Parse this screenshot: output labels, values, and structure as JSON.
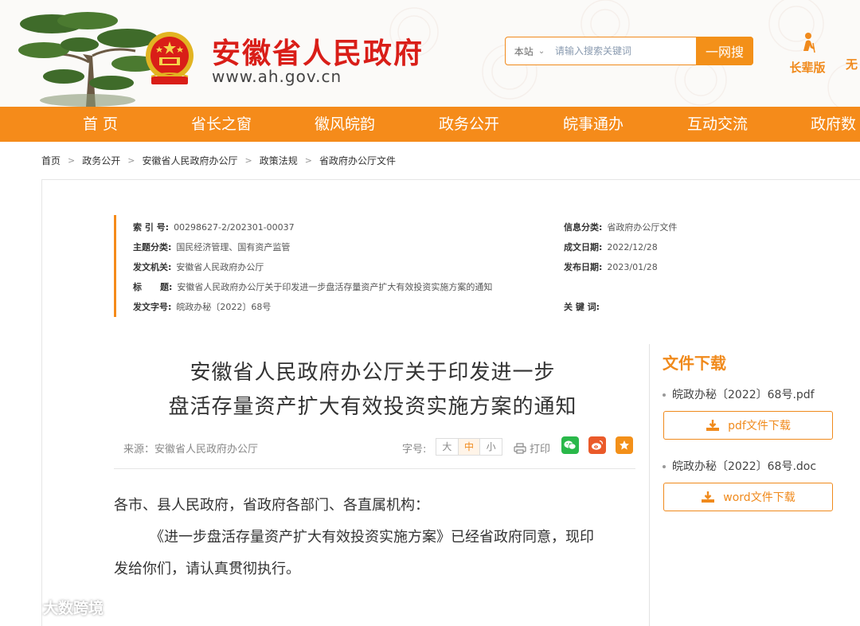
{
  "header": {
    "site_name": "安徽省人民政府",
    "site_url": "www.ah.gov.cn",
    "search": {
      "scope": "本站",
      "placeholder": "请输入搜索关键词",
      "button": "一网搜"
    },
    "elder_mode": "长辈版",
    "accessibility": "无"
  },
  "nav": {
    "items": [
      "首 页",
      "省长之窗",
      "徽风皖韵",
      "政务公开",
      "皖事通办",
      "互动交流",
      "政府数"
    ]
  },
  "breadcrumb": [
    "首页",
    "政务公开",
    "安徽省人民政府办公厅",
    "政策法规",
    "省政府办公厅文件"
  ],
  "meta": {
    "index_key": "索 引 号:",
    "index_val": "00298627-2/202301-00037",
    "category_key": "信息分类:",
    "category_val": "省政府办公厅文件",
    "topic_key": "主题分类:",
    "topic_val": "国民经济管理、国有资产监管",
    "created_key": "成文日期:",
    "created_val": "2022/12/28",
    "issuer_key": "发文机关:",
    "issuer_val": "安徽省人民政府办公厅",
    "published_key": "发布日期:",
    "published_val": "2023/01/28",
    "title_key": "标      题:",
    "title_val": "安徽省人民政府办公厅关于印发进一步盘活存量资产扩大有效投资实施方案的通知",
    "docno_key": "发文字号:",
    "docno_val": "皖政办秘〔2022〕68号",
    "keywords_key": "关 键 词:"
  },
  "article": {
    "title_line1": "安徽省人民政府办公厅关于印发进一步",
    "title_line2": "盘活存量资产扩大有效投资实施方案的通知",
    "source": "来源：安徽省人民政府办公厅",
    "font_label": "字号:",
    "font_sizes": [
      "大",
      "中",
      "小"
    ],
    "print": "打印",
    "salutation": "各市、县人民政府，省政府各部门、各直属机构：",
    "para1_line1": "《进一步盘活存量资产扩大有效投资实施方案》已经省政府同意，现印",
    "para1_line2": "发给你们，请认真贯彻执行。"
  },
  "downloads": {
    "title": "文件下载",
    "files": [
      {
        "name": "皖政办秘〔2022〕68号.pdf",
        "button": "pdf文件下载"
      },
      {
        "name": "皖政办秘〔2022〕68号.doc",
        "button": "word文件下载"
      }
    ]
  },
  "watermark": "大数跨境",
  "colors": {
    "brand_red": "#d91e18",
    "nav_orange": "#f58b1a",
    "accent_orange": "#f08a1c"
  }
}
